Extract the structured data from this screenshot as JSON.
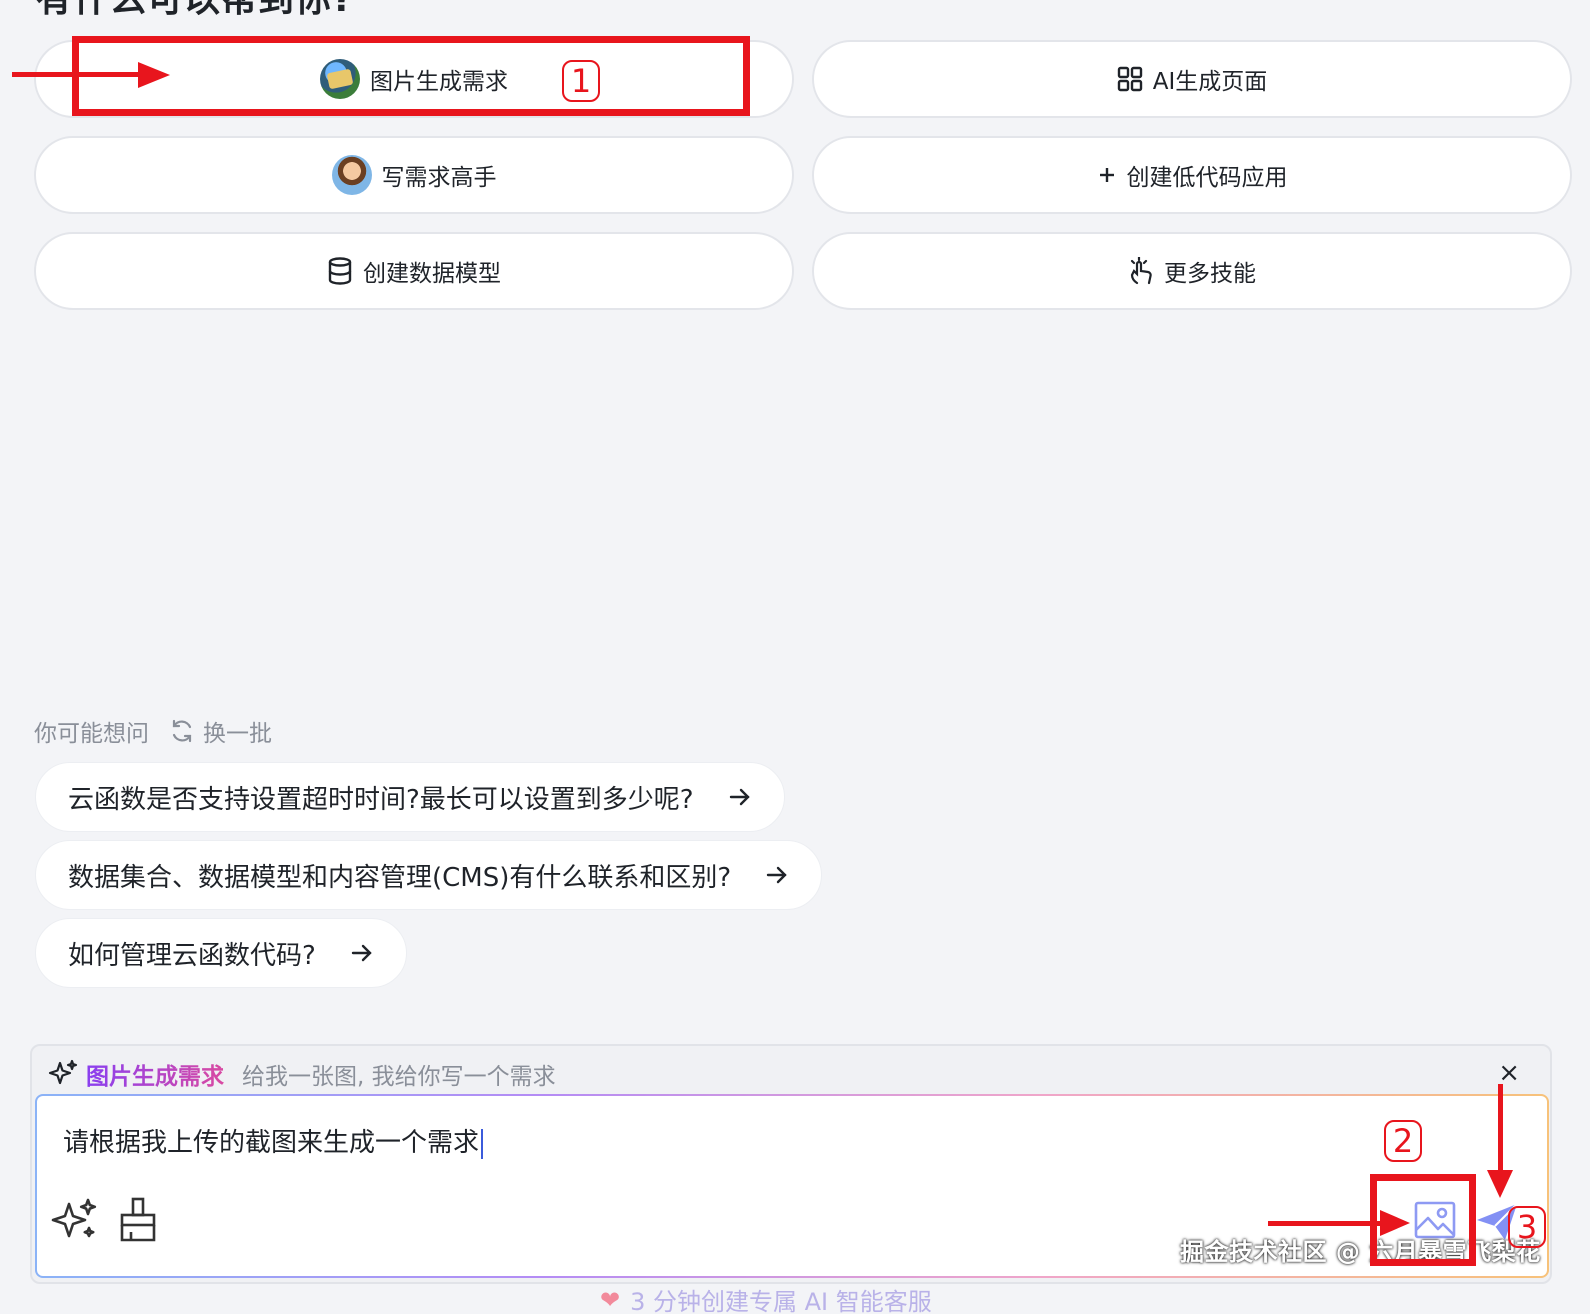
{
  "page_title": "有什么可以帮到你?",
  "skills": [
    {
      "label": "图片生成需求",
      "icon": "map-avatar"
    },
    {
      "label": "AI生成页面",
      "icon": "grid-icon"
    },
    {
      "label": "写需求高手",
      "icon": "kid-avatar"
    },
    {
      "label": "创建低代码应用",
      "icon": "plus-icon"
    },
    {
      "label": "创建数据模型",
      "icon": "database-icon"
    },
    {
      "label": "更多技能",
      "icon": "pointer-hand-icon"
    }
  ],
  "suggestions": {
    "title": "你可能想问",
    "refresh_label": "换一批",
    "items": [
      "云函数是否支持设置超时时间?最长可以设置到多少呢?",
      "数据集合、数据模型和内容管理(CMS)有什么联系和区别?",
      "如何管理云函数代码?"
    ]
  },
  "composer": {
    "skill_tag": "图片生成需求",
    "skill_desc": "给我一张图, 我给你写一个需求",
    "close_label": "×",
    "input_value": "请根据我上传的截图来生成一个需求"
  },
  "footer_hint": "3 分钟创建专属 AI 智能客服",
  "watermark": "掘金技术社区 @ 六月暴雪飞梨花",
  "annotations": [
    "1",
    "2",
    "3"
  ],
  "colors": {
    "annotation_red": "#e8151d",
    "accent_purple": "#8a3ff0",
    "send_blue": "#6d7cf2"
  }
}
